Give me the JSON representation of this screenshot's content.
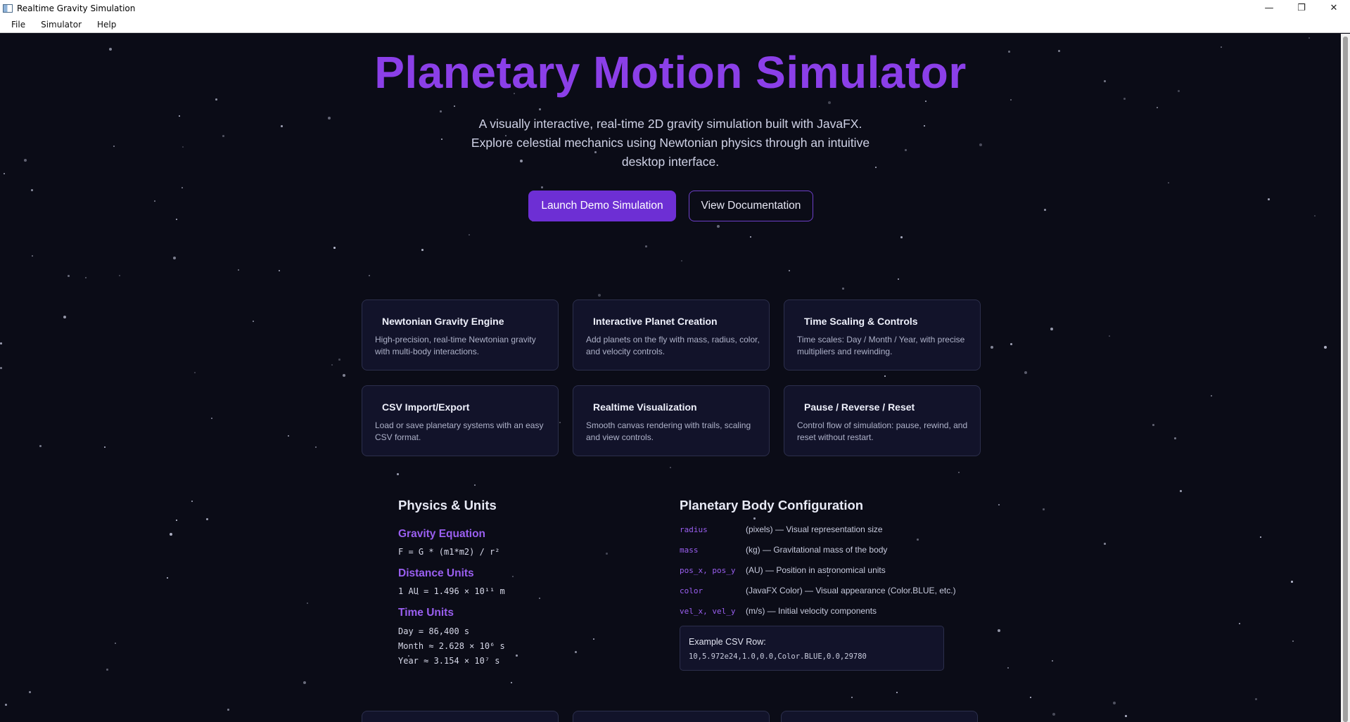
{
  "window": {
    "title": "Realtime Gravity Simulation",
    "minimize": "—",
    "maximize": "❐",
    "close": "✕"
  },
  "menu": [
    "File",
    "Simulator",
    "Help"
  ],
  "hero": {
    "title": "Planetary Motion Simulator",
    "subtitle_lines": [
      "A visually interactive, real-time 2D gravity simulation built with JavaFX.",
      "Explore celestial mechanics using Newtonian physics through an intuitive",
      "desktop interface."
    ],
    "primary_button": "Launch Demo Simulation",
    "secondary_button": "View Documentation"
  },
  "features": [
    {
      "title": "Newtonian Gravity Engine",
      "desc": "High-precision, real-time Newtonian gravity with multi-body interactions."
    },
    {
      "title": "Interactive Planet Creation",
      "desc": "Add planets on the fly with mass, radius, color, and velocity controls."
    },
    {
      "title": "Time Scaling & Controls",
      "desc": "Time scales: Day / Month / Year, with precise multipliers and rewinding."
    },
    {
      "title": "CSV Import/Export",
      "desc": "Load or save planetary systems with an easy CSV format."
    },
    {
      "title": "Realtime Visualization",
      "desc": "Smooth canvas rendering with trails, scaling and view controls."
    },
    {
      "title": "Pause / Reverse / Reset",
      "desc": "Control flow of simulation: pause, rewind, and reset without restart."
    }
  ],
  "physics": {
    "title": "Physics & Units",
    "gravity_title": "Gravity Equation",
    "gravity_eq": "F = G * (m1*m2) / r²",
    "distance_title": "Distance Units",
    "distance_val": "1 AU = 1.496 × 10¹¹ m",
    "time_title": "Time Units",
    "time_vals": [
      "Day = 86,400 s",
      "Month ≈ 2.628 × 10⁶ s",
      "Year ≈ 3.154 × 10⁷ s"
    ]
  },
  "config": {
    "title": "Planetary Body Configuration",
    "rows": [
      {
        "key": "radius",
        "desc": "(pixels) — Visual representation size"
      },
      {
        "key": "mass",
        "desc": "(kg) — Gravitational mass of the body"
      },
      {
        "key": "pos_x, pos_y",
        "desc": "(AU) — Position in astronomical units"
      },
      {
        "key": "color",
        "desc": "(JavaFX Color) — Visual appearance (Color.BLUE, etc.)"
      },
      {
        "key": "vel_x, vel_y",
        "desc": "(m/s) — Initial velocity components"
      }
    ],
    "example_label": "Example CSV Row:",
    "example_row": "10,5.972e24,1.0,0.0,Color.BLUE,0.0,29780"
  },
  "colors": {
    "accent": "#8b3fe8",
    "background": "#0b0c17",
    "card": "#12132a"
  }
}
